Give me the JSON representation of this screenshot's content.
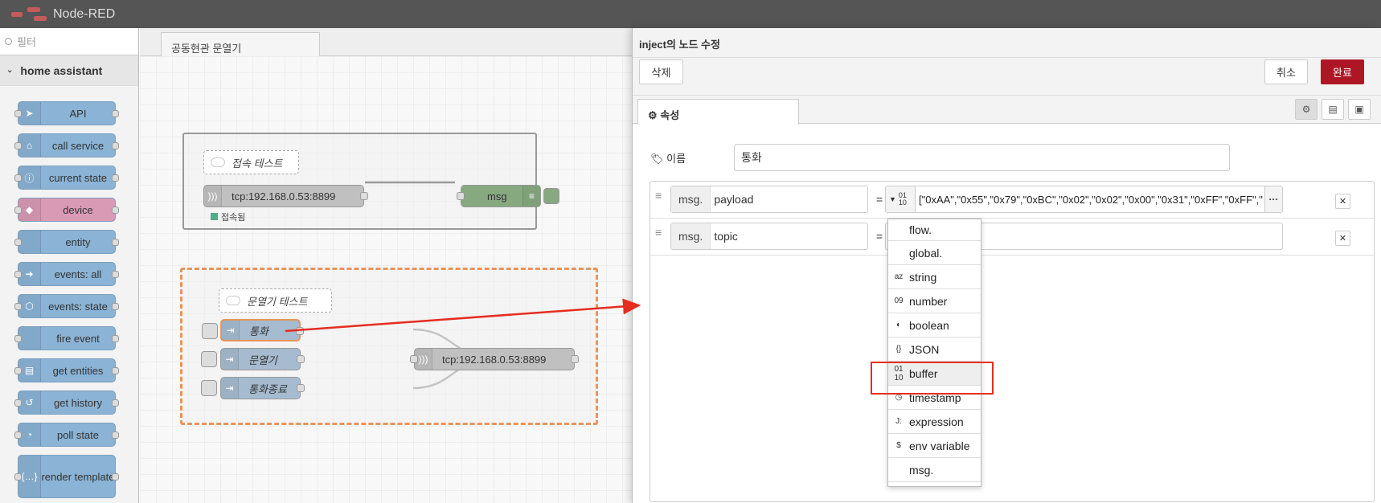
{
  "header": {
    "app_title": "Node-RED"
  },
  "palette": {
    "filter_placeholder": "필터",
    "category": "home assistant",
    "nodes": [
      {
        "label": "API",
        "icon": "send-icon",
        "color": "#8ab3d5"
      },
      {
        "label": "call service",
        "icon": "router-icon",
        "color": "#8ab3d5"
      },
      {
        "label": "current state",
        "icon": "info-icon",
        "color": "#8ab3d5"
      },
      {
        "label": "device",
        "icon": "cube-icon",
        "color": "#d99ab5"
      },
      {
        "label": "entity",
        "icon": "circle-icon",
        "color": "#8ab3d5"
      },
      {
        "label": "events: all",
        "icon": "arrow-icon",
        "color": "#8ab3d5"
      },
      {
        "label": "events: state",
        "icon": "hexagon-icon",
        "color": "#8ab3d5"
      },
      {
        "label": "fire event",
        "icon": "antenna-icon",
        "color": "#8ab3d5"
      },
      {
        "label": "get entities",
        "icon": "document-icon",
        "color": "#8ab3d5"
      },
      {
        "label": "get history",
        "icon": "history-icon",
        "color": "#8ab3d5"
      },
      {
        "label": "poll state",
        "icon": "timer-icon",
        "color": "#8ab3d5"
      },
      {
        "label": "render template",
        "icon": "braces-icon",
        "color": "#8ab3d5"
      }
    ]
  },
  "workspace": {
    "tab_label": "공동현관 문열기",
    "group1": {
      "comment": "접속 테스트",
      "tcp_node": "tcp:192.168.0.53:8899",
      "status": "접속됨",
      "debug_node": "msg"
    },
    "group2": {
      "comment": "문열기 테스트",
      "inject1": "통화",
      "inject2": "문열기",
      "inject3": "통화종료",
      "tcp_node": "tcp:192.168.0.53:8899"
    }
  },
  "tray": {
    "title": "inject의 노드 수정",
    "delete_label": "삭제",
    "cancel_label": "취소",
    "done_label": "완료",
    "properties_tab": "속성",
    "name_label": "이름",
    "name_value": "통화",
    "props": [
      {
        "prefix": "msg.",
        "key": "payload",
        "value": "[\"0xAA\",\"0x55\",\"0x79\",\"0xBC\",\"0x02\",\"0x02\",\"0x00\",\"0x31\",\"0xFF\",\"0xFF\",\""
      },
      {
        "prefix": "msg.",
        "key": "topic",
        "value": ""
      }
    ],
    "equals": "=",
    "type_selector": {
      "top": "01",
      "bottom": "10"
    }
  },
  "type_dropdown": {
    "items": [
      {
        "icon": "",
        "label": "flow."
      },
      {
        "icon": "",
        "label": "global."
      },
      {
        "icon": "az",
        "label": "string"
      },
      {
        "icon": "09",
        "label": "number"
      },
      {
        "icon": "◐",
        "label": "boolean"
      },
      {
        "icon": "{}",
        "label": "JSON"
      },
      {
        "icon": "01\n10",
        "label": "buffer"
      },
      {
        "icon": "◷",
        "label": "timestamp"
      },
      {
        "icon": "J:",
        "label": "expression"
      },
      {
        "icon": "$",
        "label": "env variable"
      },
      {
        "icon": "",
        "label": "msg."
      }
    ],
    "highlighted": "buffer"
  },
  "colors": {
    "accent_red": "#ad1625",
    "annotation_red": "#e52d20",
    "inject_node": "#a6bbcf",
    "tcp_node": "#c0c0c0",
    "debug_node": "#87a980"
  }
}
